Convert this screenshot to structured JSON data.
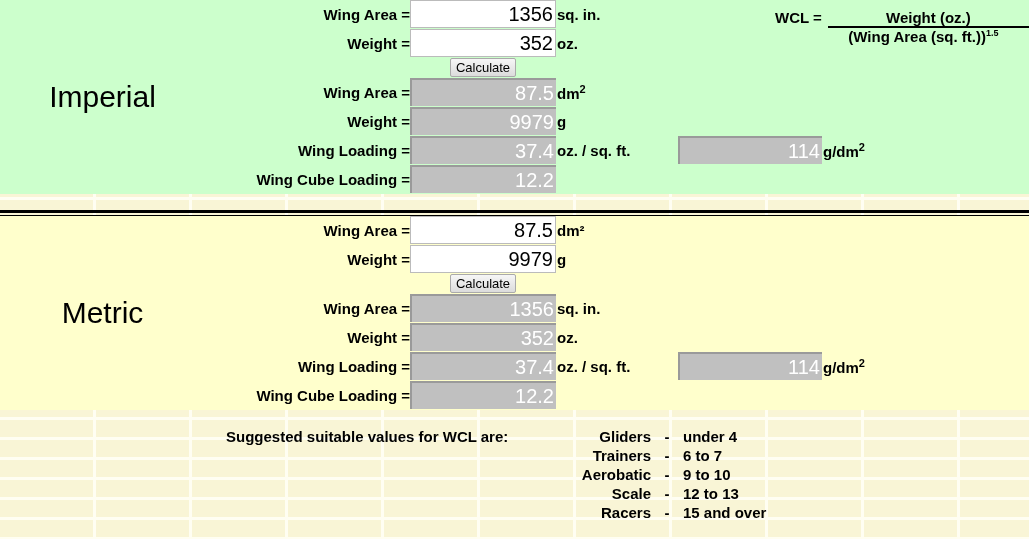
{
  "sections": [
    {
      "kind": "imperial",
      "title": "Imperial",
      "inputs": [
        {
          "label": "Wing Area =",
          "value": "1356",
          "unit": "sq. in."
        },
        {
          "label": "Weight =",
          "value": "352",
          "unit": "oz."
        }
      ],
      "button": "Calculate",
      "outputs": [
        {
          "label": "Wing Area =",
          "value": "87.5",
          "unit": "dm$^{2}$"
        },
        {
          "label": "Weight =",
          "value": "9979",
          "unit": "g"
        },
        {
          "label": "Wing Loading =",
          "value": "37.4",
          "unit": "oz. / sq. ft.",
          "extra": {
            "value": "114",
            "unit": "g/dm$^{2}$"
          }
        },
        {
          "label": "Wing Cube Loading =",
          "value": "12.2"
        }
      ],
      "formula": {
        "lhs": "WCL =",
        "numerator": "Weight (oz.)",
        "denominator": "(Wing Area (sq. ft.))$^{1.5}$"
      }
    },
    {
      "kind": "metric",
      "title": "Metric",
      "inputs": [
        {
          "label": "Wing Area =",
          "value": "87.5",
          "unit": "dm²"
        },
        {
          "label": "Weight =",
          "value": "9979",
          "unit": "g"
        }
      ],
      "button": "Calculate",
      "outputs": [
        {
          "label": "Wing Area =",
          "value": "1356",
          "unit": "sq. in."
        },
        {
          "label": "Weight =",
          "value": "352",
          "unit": "oz."
        },
        {
          "label": "Wing Loading =",
          "value": "37.4",
          "unit": "oz. / sq. ft.",
          "extra": {
            "value": "114",
            "unit": "g/dm$^{2}$"
          }
        },
        {
          "label": "Wing Cube Loading =",
          "value": "12.2"
        }
      ]
    }
  ],
  "suggestions": {
    "heading": "Suggested suitable values for WCL are:",
    "rows": [
      {
        "type": "Gliders",
        "separator": "-",
        "range": "under 4"
      },
      {
        "type": "Trainers",
        "separator": "-",
        "range": "6 to 7"
      },
      {
        "type": "Aerobatic",
        "separator": "-",
        "range": "9 to 10"
      },
      {
        "type": "Scale",
        "separator": "-",
        "range": "12 to 13"
      },
      {
        "type": "Racers",
        "separator": "-",
        "range": "15 and over"
      }
    ]
  }
}
